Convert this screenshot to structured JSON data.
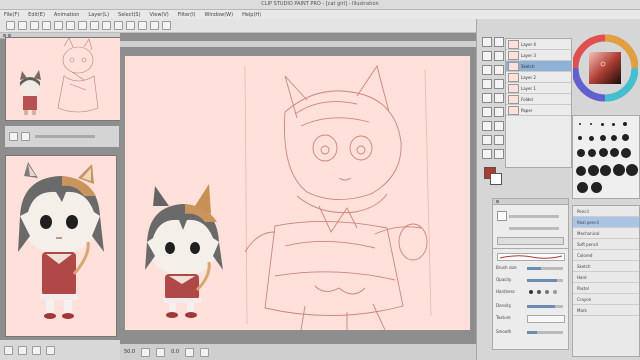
{
  "window": {
    "title": "CLIP STUDIO PAINT PRO - [cat girl] - Illustration"
  },
  "menubar": {
    "items": [
      "File(F)",
      "Edit(E)",
      "Animation",
      "Layer(L)",
      "Select(S)",
      "View(V)",
      "Filter(I)",
      "Window(W)",
      "Help(H)"
    ]
  },
  "statusbar": {
    "zoom": "50.0",
    "angle": "0.0"
  },
  "layers": {
    "items": [
      "Layer 4",
      "Layer 3",
      "Sketch",
      "Layer 2",
      "Layer 1",
      "Folder",
      "Paper"
    ]
  },
  "subtool": {
    "items": [
      "Pencil",
      "Real pencil",
      "Mechanical",
      "Soft pencil",
      "Colored",
      "Sketch",
      "Hard",
      "Pastel",
      "Crayon",
      "Mark"
    ]
  },
  "brushprop": {
    "labels": [
      "Brush size",
      "Opacity",
      "Hardness",
      "Density",
      "Texture",
      "Smooth"
    ]
  },
  "colors": {
    "sketch": "#c87a70",
    "canvas": "#ffe0da",
    "accent": "#6c8db3"
  }
}
